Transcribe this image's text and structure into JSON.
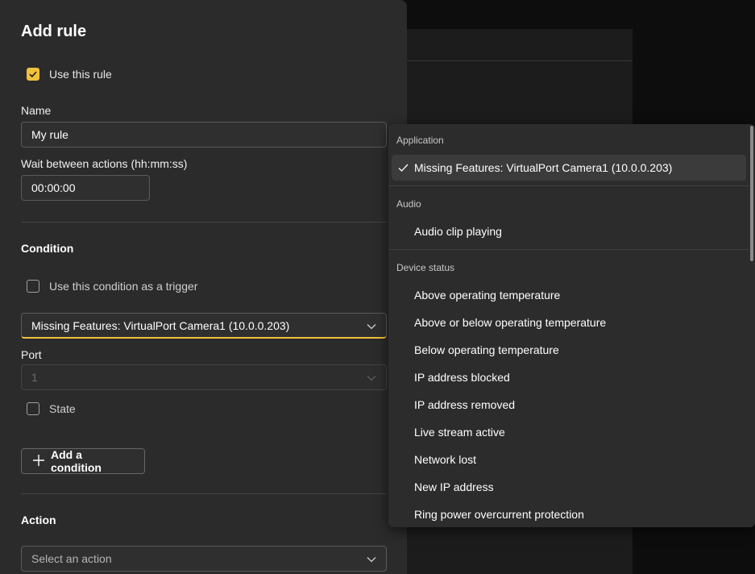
{
  "dialog": {
    "title": "Add rule",
    "use_rule_label": "Use this rule",
    "use_rule_checked": true,
    "name_label": "Name",
    "name_value": "My rule",
    "wait_label": "Wait between actions (hh:mm:ss)",
    "wait_value": "00:00:00",
    "condition_heading": "Condition",
    "trigger_label": "Use this condition as a trigger",
    "trigger_checked": false,
    "condition_value": "Missing Features: VirtualPort Camera1 (10.0.0.203)",
    "port_label": "Port",
    "port_value": "1",
    "state_label": "State",
    "state_checked": false,
    "add_condition_label": "Add a condition",
    "action_heading": "Action",
    "action_placeholder": "Select an action"
  },
  "menu": {
    "groups": [
      {
        "header": "Application",
        "items": [
          "Missing Features: VirtualPort Camera1 (10.0.0.203)"
        ]
      },
      {
        "header": "Audio",
        "items": [
          "Audio clip playing"
        ]
      },
      {
        "header": "Device status",
        "items": [
          "Above operating temperature",
          "Above or below operating temperature",
          "Below operating temperature",
          "IP address blocked",
          "IP address removed",
          "Live stream active",
          "Network lost",
          "New IP address",
          "Ring power overcurrent protection"
        ]
      }
    ],
    "selected_item": "Missing Features: VirtualPort Camera1 (10.0.0.203)"
  },
  "colors": {
    "accent": "#f0c23c",
    "dialog_bg": "#2b2b2b",
    "menu_bg": "#2c2c2c"
  }
}
